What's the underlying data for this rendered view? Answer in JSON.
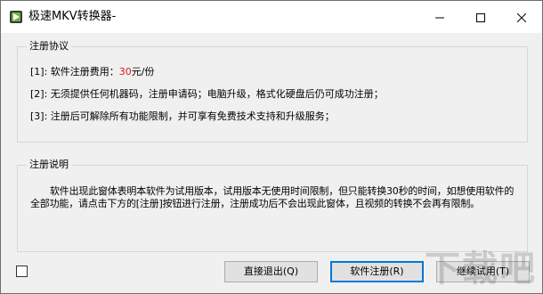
{
  "window": {
    "title": "极速MKV转换器-",
    "controls": {
      "minimize_icon": "minimize-icon",
      "maximize_icon": "maximize-icon",
      "close_icon": "close-icon"
    }
  },
  "agreement": {
    "title": "注册协议",
    "line1_prefix": "[1]:  软件注册费用：",
    "line1_price": "30",
    "line1_suffix": "元/份",
    "line2": "[2]:  无须提供任何机器码，注册申请码；电脑升级，格式化硬盘后仍可成功注册；",
    "line3": "[3]:  注册后可解除所有功能限制，并可享有免费技术支持和升级服务；"
  },
  "explanation": {
    "title": "注册说明",
    "text": "软件出现此窗体表明本软件为试用版本，试用版本无使用时间限制，但只能转换30秒的时间，如想使用软件的全部功能，请点击下方的[注册]按钮进行注册，注册成功后不会出现此窗体，且视频的转换不会再有限制。"
  },
  "buttons": {
    "exit": "直接退出(Q)",
    "register": "软件注册(R)",
    "trial": "继续试用(T)"
  },
  "watermark": "下载吧",
  "colors": {
    "price": "#e0191b",
    "focus_border": "#0078d7",
    "background": "#f0f0f0"
  }
}
